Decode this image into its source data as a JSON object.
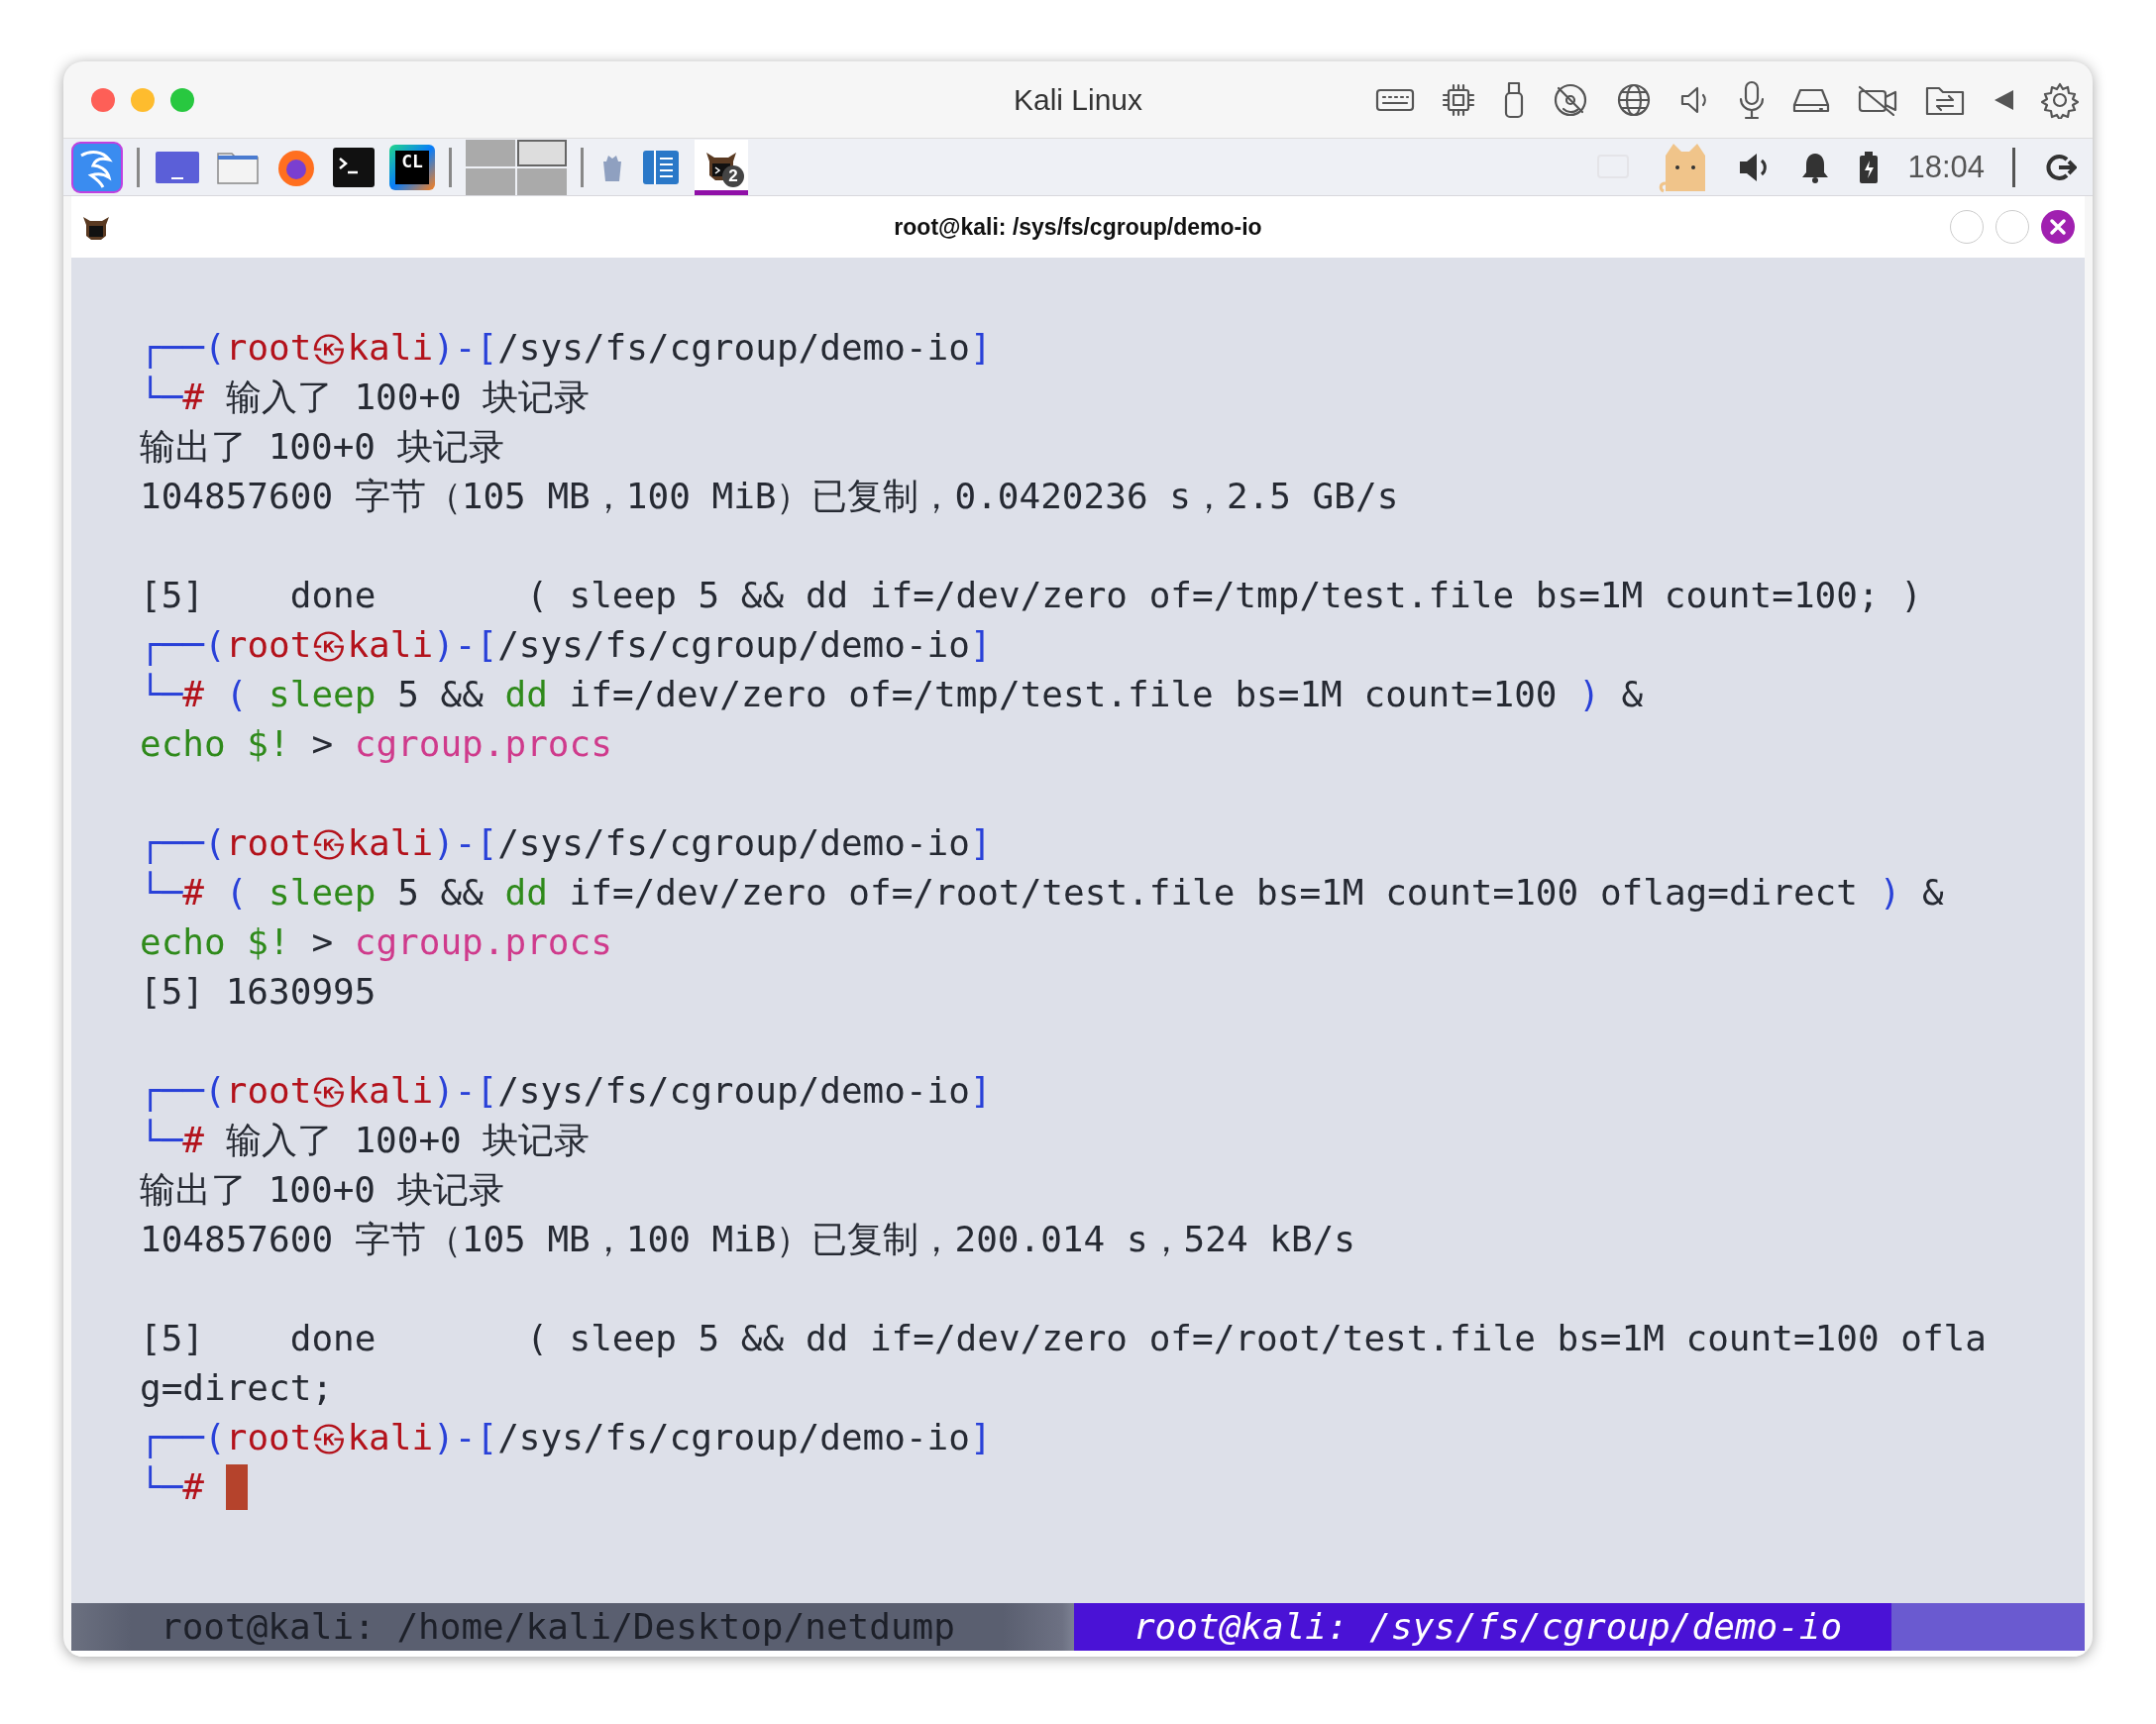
{
  "window": {
    "title": "Kali Linux"
  },
  "panel": {
    "ide_logo_text": "CL",
    "workspaces": [
      {
        "selected": false
      },
      {
        "selected": true
      },
      {
        "selected": false
      },
      {
        "selected": false
      }
    ],
    "tasks": [
      {
        "badge": "2",
        "selected": true
      }
    ],
    "clock": "18:04"
  },
  "terminal": {
    "title": "root@kali: /sys/fs/cgroup/demo-io",
    "lines": [
      {
        "kind": "text",
        "segments": [
          {
            "text": "┌──(",
            "kind": "frame"
          },
          {
            "text": "root㉿kali",
            "kind": "user"
          },
          {
            "text": ")-[",
            "kind": "frame"
          },
          {
            "text": "/sys/fs/cgroup/demo-io",
            "kind": "plain"
          },
          {
            "text": "]",
            "kind": "frame"
          }
        ]
      },
      {
        "kind": "text",
        "segments": [
          {
            "text": "└─",
            "kind": "frame"
          },
          {
            "text": "# ",
            "kind": "user"
          },
          {
            "text": "输入了 100+0 块记录",
            "kind": "plain"
          }
        ]
      },
      {
        "kind": "text",
        "segments": [
          {
            "text": "输出了 100+0 块记录",
            "kind": "plain"
          }
        ]
      },
      {
        "kind": "text",
        "segments": [
          {
            "text": "104857600 字节（105 MB，100 MiB）已复制，0.0420236 s，2.5 GB/s",
            "kind": "plain"
          }
        ]
      },
      {
        "kind": "blank"
      },
      {
        "kind": "text",
        "segments": [
          {
            "text": "[5]    done       ( sleep 5 && dd if=/dev/zero of=/tmp/test.file bs=1M count=100; )",
            "kind": "plain"
          }
        ]
      },
      {
        "kind": "text",
        "segments": [
          {
            "text": "┌──(",
            "kind": "frame"
          },
          {
            "text": "root㉿kali",
            "kind": "user"
          },
          {
            "text": ")-[",
            "kind": "frame"
          },
          {
            "text": "/sys/fs/cgroup/demo-io",
            "kind": "plain"
          },
          {
            "text": "]",
            "kind": "frame"
          }
        ]
      },
      {
        "kind": "text",
        "segments": [
          {
            "text": "└─",
            "kind": "frame"
          },
          {
            "text": "# ",
            "kind": "user"
          },
          {
            "text": "( ",
            "kind": "frame"
          },
          {
            "text": "sleep",
            "kind": "command"
          },
          {
            "text": " 5 && ",
            "kind": "plain"
          },
          {
            "text": "dd",
            "kind": "command"
          },
          {
            "text": " if=/dev/zero of=/tmp/test.file bs=1M count=100 ",
            "kind": "plain"
          },
          {
            "text": ")",
            "kind": "frame"
          },
          {
            "text": " &",
            "kind": "plain"
          }
        ]
      },
      {
        "kind": "text",
        "segments": [
          {
            "text": "echo $!",
            "kind": "command"
          },
          {
            "text": " > ",
            "kind": "plain"
          },
          {
            "text": "cgroup.procs",
            "kind": "file"
          }
        ]
      },
      {
        "kind": "blank"
      },
      {
        "kind": "text",
        "segments": [
          {
            "text": "┌──(",
            "kind": "frame"
          },
          {
            "text": "root㉿kali",
            "kind": "user"
          },
          {
            "text": ")-[",
            "kind": "frame"
          },
          {
            "text": "/sys/fs/cgroup/demo-io",
            "kind": "plain"
          },
          {
            "text": "]",
            "kind": "frame"
          }
        ]
      },
      {
        "kind": "text",
        "segments": [
          {
            "text": "└─",
            "kind": "frame"
          },
          {
            "text": "# ",
            "kind": "user"
          },
          {
            "text": "( ",
            "kind": "frame"
          },
          {
            "text": "sleep",
            "kind": "command"
          },
          {
            "text": " 5 && ",
            "kind": "plain"
          },
          {
            "text": "dd",
            "kind": "command"
          },
          {
            "text": " if=/dev/zero of=/root/test.file bs=1M count=100 oflag=direct ",
            "kind": "plain"
          },
          {
            "text": ")",
            "kind": "frame"
          },
          {
            "text": " &",
            "kind": "plain"
          }
        ]
      },
      {
        "kind": "text",
        "segments": [
          {
            "text": "echo $!",
            "kind": "command"
          },
          {
            "text": " > ",
            "kind": "plain"
          },
          {
            "text": "cgroup.procs",
            "kind": "file"
          }
        ]
      },
      {
        "kind": "text",
        "segments": [
          {
            "text": "[5] 1630995",
            "kind": "plain"
          }
        ]
      },
      {
        "kind": "blank"
      },
      {
        "kind": "text",
        "segments": [
          {
            "text": "┌──(",
            "kind": "frame"
          },
          {
            "text": "root㉿kali",
            "kind": "user"
          },
          {
            "text": ")-[",
            "kind": "frame"
          },
          {
            "text": "/sys/fs/cgroup/demo-io",
            "kind": "plain"
          },
          {
            "text": "]",
            "kind": "frame"
          }
        ]
      },
      {
        "kind": "text",
        "segments": [
          {
            "text": "└─",
            "kind": "frame"
          },
          {
            "text": "# ",
            "kind": "user"
          },
          {
            "text": "输入了 100+0 块记录",
            "kind": "plain"
          }
        ]
      },
      {
        "kind": "text",
        "segments": [
          {
            "text": "输出了 100+0 块记录",
            "kind": "plain"
          }
        ]
      },
      {
        "kind": "text",
        "segments": [
          {
            "text": "104857600 字节（105 MB，100 MiB）已复制，200.014 s，524 kB/s",
            "kind": "plain"
          }
        ]
      },
      {
        "kind": "blank"
      },
      {
        "kind": "text",
        "segments": [
          {
            "text": "[5]    done       ( sleep 5 && dd if=/dev/zero of=/root/test.file bs=1M count=100 ofla",
            "kind": "plain"
          }
        ]
      },
      {
        "kind": "text",
        "segments": [
          {
            "text": "g=direct;",
            "kind": "plain"
          }
        ]
      },
      {
        "kind": "text",
        "segments": [
          {
            "text": "┌──(",
            "kind": "frame"
          },
          {
            "text": "root㉿kali",
            "kind": "user"
          },
          {
            "text": ")-[",
            "kind": "frame"
          },
          {
            "text": "/sys/fs/cgroup/demo-io",
            "kind": "plain"
          },
          {
            "text": "]",
            "kind": "frame"
          }
        ]
      },
      {
        "kind": "text",
        "cursor": true,
        "segments": [
          {
            "text": "└─",
            "kind": "frame"
          },
          {
            "text": "# ",
            "kind": "user"
          }
        ]
      }
    ]
  },
  "tmux_tabs": [
    {
      "label": "root@kali: /home/kali/Desktop/netdump",
      "selected": false
    },
    {
      "label": "root@kali: /sys/fs/cgroup/demo-io",
      "selected": true
    }
  ]
}
